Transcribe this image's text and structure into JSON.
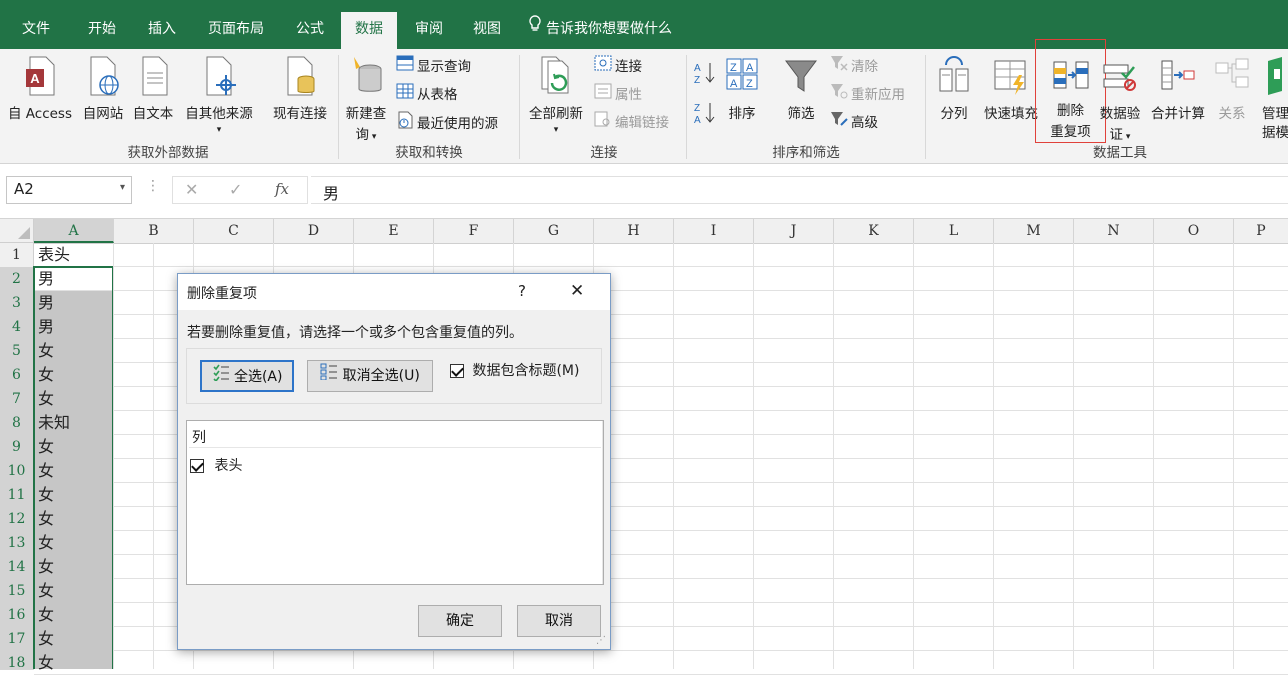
{
  "tabs": [
    "文件",
    "开始",
    "插入",
    "页面布局",
    "公式",
    "数据",
    "审阅",
    "视图"
  ],
  "tell_me": "告诉我你想要做什么",
  "ribbon": {
    "get_external": {
      "label": "获取外部数据",
      "from_access": "自 Access",
      "from_web": "自网站",
      "from_text": "自文本",
      "from_other": "自其他来源",
      "existing": "现有连接"
    },
    "get_transform": {
      "label": "获取和转换",
      "new_query_1": "新建查",
      "new_query_2": "询",
      "show_queries": "显示查询",
      "from_table": "从表格",
      "recent_sources": "最近使用的源"
    },
    "connections": {
      "label": "连接",
      "refresh_all": "全部刷新",
      "connections": "连接",
      "properties": "属性",
      "edit_links": "编辑链接"
    },
    "sort_filter": {
      "label": "排序和筛选",
      "sort": "排序",
      "filter": "筛选",
      "clear": "清除",
      "reapply": "重新应用",
      "advanced": "高级"
    },
    "data_tools": {
      "label": "数据工具",
      "text_to_columns": "分列",
      "flash_fill": "快速填充",
      "remove_dup_1": "删除",
      "remove_dup_2": "重复项",
      "validation_1": "数据验",
      "validation_2": "证",
      "consolidate": "合并计算",
      "relationships": "关系",
      "manage_model_1": "管理",
      "manage_model_2": "据模"
    }
  },
  "formula_bar": {
    "name_box": "A2",
    "fx": "fx",
    "value": "男"
  },
  "columns": [
    "A",
    "B",
    "C",
    "D",
    "E",
    "F",
    "G",
    "H",
    "I",
    "J",
    "K",
    "L",
    "M",
    "N",
    "O",
    "P"
  ],
  "rows": [
    {
      "num": "1",
      "a": "表头"
    },
    {
      "num": "2",
      "a": "男"
    },
    {
      "num": "3",
      "a": "男"
    },
    {
      "num": "4",
      "a": "男"
    },
    {
      "num": "5",
      "a": "女"
    },
    {
      "num": "6",
      "a": "女"
    },
    {
      "num": "7",
      "a": "女"
    },
    {
      "num": "8",
      "a": "未知"
    },
    {
      "num": "9",
      "a": "女"
    },
    {
      "num": "10",
      "a": "女"
    },
    {
      "num": "11",
      "a": "女"
    },
    {
      "num": "12",
      "a": "女"
    },
    {
      "num": "13",
      "a": "女"
    },
    {
      "num": "14",
      "a": "女"
    },
    {
      "num": "15",
      "a": "女"
    },
    {
      "num": "16",
      "a": "女"
    },
    {
      "num": "17",
      "a": "女"
    },
    {
      "num": "18",
      "a": "女"
    }
  ],
  "dialog": {
    "title": "删除重复项",
    "help": "?",
    "close": "✕",
    "instruction": "若要删除重复值，请选择一个或多个包含重复值的列。",
    "select_all": "全选(A)",
    "unselect_all": "取消全选(U)",
    "has_headers": "数据包含标题(M)",
    "list_header": "列",
    "list_items": [
      "表头"
    ],
    "ok": "确定",
    "cancel": "取消"
  },
  "colors": {
    "excel_green": "#217346",
    "selection_border": "#217346",
    "highlight_box": "#e0413a"
  }
}
